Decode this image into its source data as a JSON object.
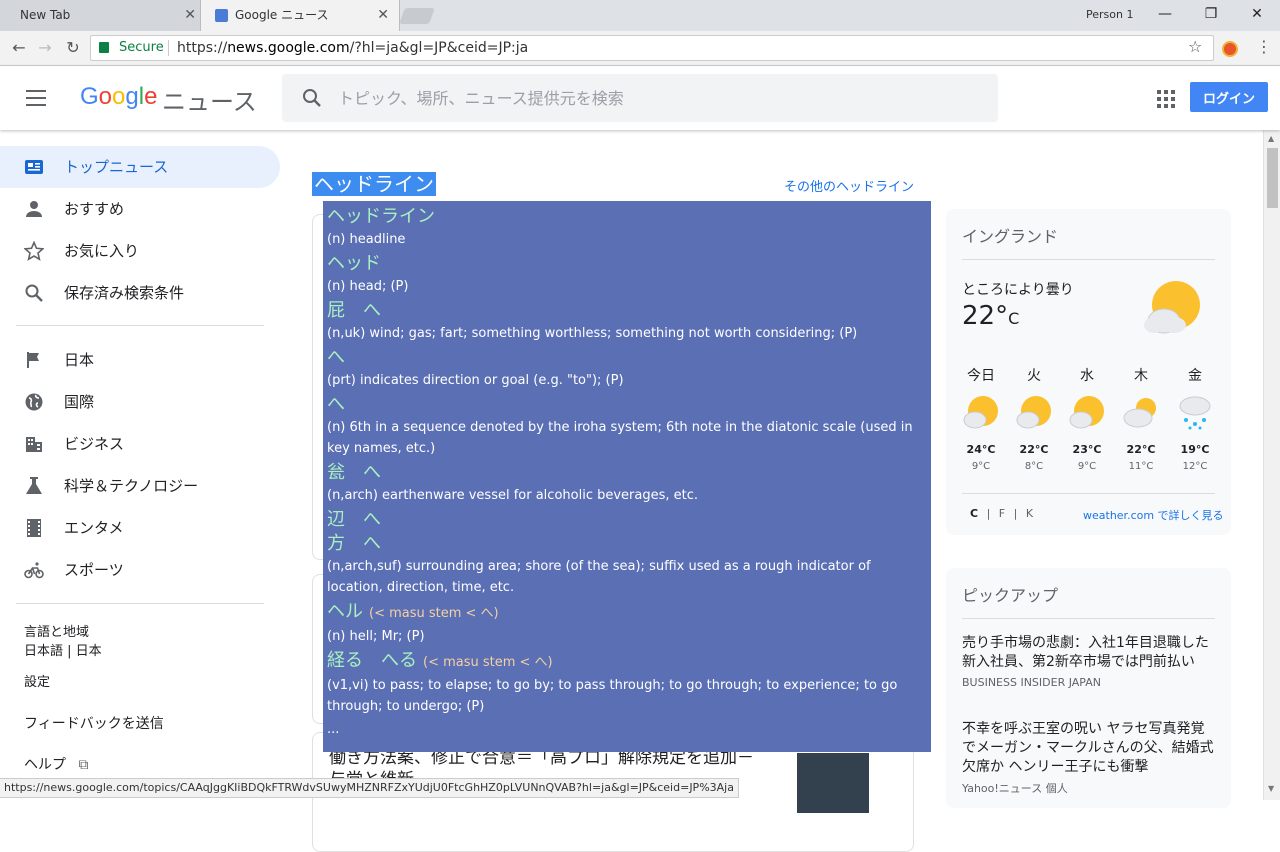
{
  "browser": {
    "tabs": [
      {
        "title": "New Tab",
        "close": "✕"
      },
      {
        "title": "Google ニュース",
        "close": "✕"
      }
    ],
    "profile": "Person 1",
    "window_controls": {
      "minimize": "—",
      "maximize": "❐",
      "close": "✕"
    },
    "secure_label": "Secure",
    "url_scheme": "https://",
    "url_host": "news.google.com",
    "url_rest": "/?hl=ja&gl=JP&ceid=JP:ja",
    "status_url": "https://news.google.com/topics/CAAqJggKIiBDQkFTRWdvSUwyMHZNRFZxYUdjU0FtcGhHZ0pLVUNnQVAB?hl=ja&gl=JP&ceid=JP%3Aja"
  },
  "header": {
    "logo_suffix": "ニュース",
    "search_placeholder": "トピック、場所、ニュース提供元を検索",
    "login_label": "ログイン"
  },
  "sidebar": {
    "items": [
      {
        "label": "トップニュース",
        "icon": "newspaper-icon"
      },
      {
        "label": "おすすめ",
        "icon": "person-icon"
      },
      {
        "label": "お気に入り",
        "icon": "star-icon"
      },
      {
        "label": "保存済み検索条件",
        "icon": "search-icon"
      }
    ],
    "sections": [
      {
        "label": "日本",
        "icon": "flag-icon"
      },
      {
        "label": "国際",
        "icon": "globe-icon"
      },
      {
        "label": "ビジネス",
        "icon": "building-icon"
      },
      {
        "label": "科学＆テクノロジー",
        "icon": "flask-icon"
      },
      {
        "label": "エンタメ",
        "icon": "film-icon"
      },
      {
        "label": "スポーツ",
        "icon": "bicycle-icon"
      }
    ],
    "language_title": "言語と地域",
    "language_value": "日本語 | 日本",
    "settings": "設定",
    "feedback": "フィードバックを送信",
    "help": "ヘルプ"
  },
  "main": {
    "headline_section": "ヘッドライン",
    "more_headlines": "その他のヘッドライン",
    "partial_story": "働き方法案、修正で合意＝「高プロ」解除規定を追加－",
    "partial_story_line2": "与党と維新"
  },
  "popup": {
    "entries": [
      {
        "word": "ヘッドライン",
        "def": "(n) headline"
      },
      {
        "word": "ヘッド",
        "def": "(n) head; (P)"
      },
      {
        "word": "屁　へ",
        "def": "(n,uk) wind; gas; fart; something worthless; something not worth considering; (P)"
      },
      {
        "word": "へ",
        "def": "(prt) indicates direction or goal (e.g. \"to\"); (P)"
      },
      {
        "word": "へ",
        "def": "(n) 6th in a sequence denoted by the iroha system; 6th note in the diatonic scale (used in key names, etc.)"
      },
      {
        "word": "瓮　へ",
        "def": "(n,arch) earthenware vessel for alcoholic beverages, etc."
      },
      {
        "word": "辺　へ",
        "def": ""
      },
      {
        "word": "方　へ",
        "def": "(n,arch,suf) surrounding area; shore (of the sea); suffix used as a rough indicator of location, direction, time, etc."
      },
      {
        "word": "ヘル",
        "hint": "(< masu stem < へ)",
        "def": "(n) hell; Mr; (P)"
      },
      {
        "word": "経る　へる",
        "hint": "(< masu stem < へ)",
        "def": "(v1,vi) to pass; to elapse; to go by; to pass through; to go through; to experience; to go through; to undergo; (P)"
      }
    ],
    "ellipsis": "..."
  },
  "weather": {
    "location": "イングランド",
    "condition": "ところにより曇り",
    "temp": "22°",
    "unit": "C",
    "days": [
      {
        "day": "今日",
        "hi": "24°C",
        "lo": "9°C",
        "icon": "partly-sunny-icon"
      },
      {
        "day": "火",
        "hi": "22°C",
        "lo": "8°C",
        "icon": "partly-sunny-icon"
      },
      {
        "day": "水",
        "hi": "23°C",
        "lo": "9°C",
        "icon": "partly-sunny-icon"
      },
      {
        "day": "木",
        "hi": "22°C",
        "lo": "11°C",
        "icon": "cloudy-icon"
      },
      {
        "day": "金",
        "hi": "19°C",
        "lo": "12°C",
        "icon": "rain-icon"
      }
    ],
    "unit_c": "C",
    "unit_f": "F",
    "unit_k": "K",
    "unit_sep": "|",
    "link": "weather.com で詳しく見る"
  },
  "pickup": {
    "title": "ピックアップ",
    "stories": [
      {
        "headline": "売り手市場の悲劇：入社1年目退職した新入社員、第2新卒市場では門前払い",
        "source": "BUSINESS INSIDER JAPAN"
      },
      {
        "headline": "不幸を呼ぶ王室の呪い ヤラセ写真発覚でメーガン・マークルさんの父、結婚式欠席か ヘンリー王子にも衝撃",
        "source": "Yahoo!ニュース 個人"
      }
    ]
  },
  "colors": {
    "accent": "#1a73e8",
    "login_bg": "#4285f4",
    "popup_bg": "#5b6fb5",
    "popup_word": "#a8f0c0",
    "active_nav_bg": "#e8f0fe"
  }
}
